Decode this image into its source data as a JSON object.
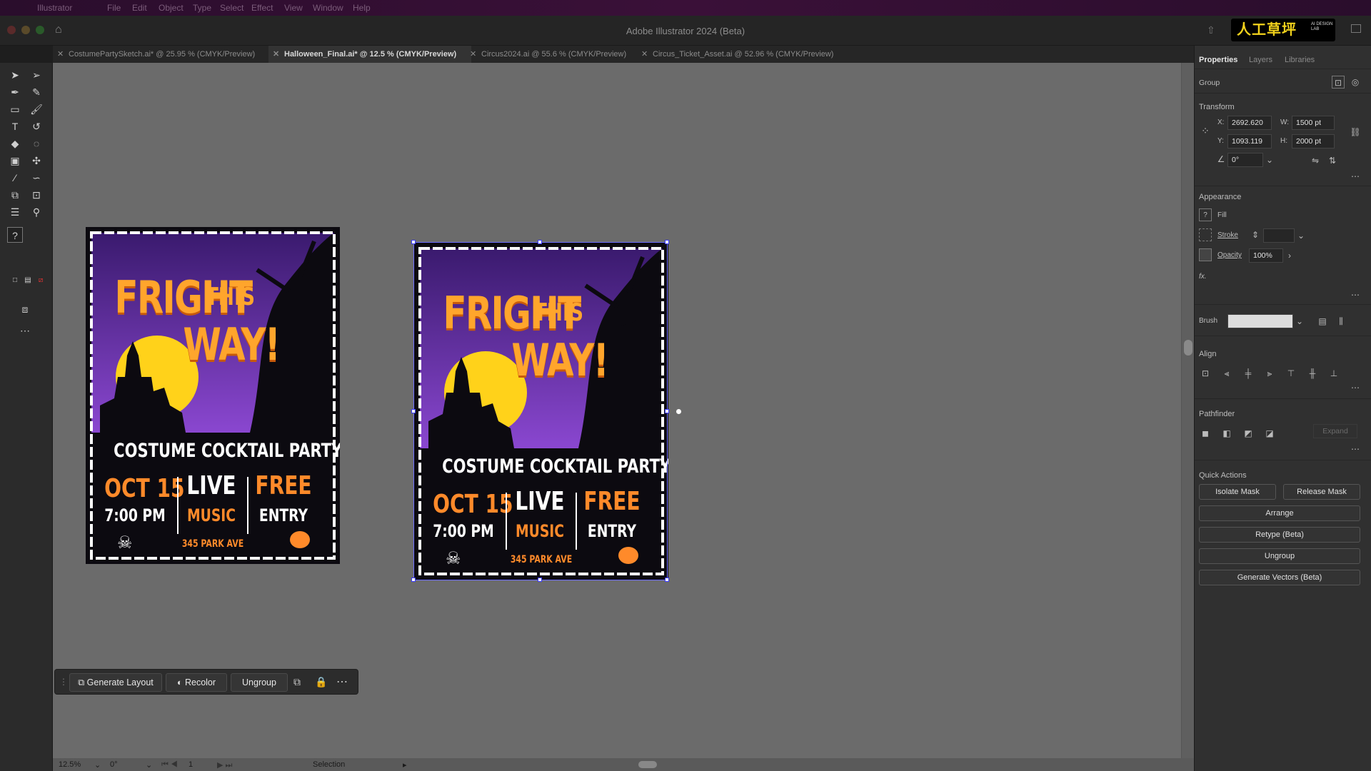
{
  "menubar": {
    "items": [
      "Illustrator",
      "File",
      "Edit",
      "Object",
      "Type",
      "Select",
      "Effect",
      "View",
      "Window",
      "Help"
    ]
  },
  "window": {
    "title": "Adobe Illustrator 2024 (Beta)",
    "brand_text": "人工草坪",
    "brand_small": "AI DESIGN LAB"
  },
  "tabs": [
    {
      "label": "CostumePartySketch.ai* @ 25.95 % (CMYK/Preview)",
      "active": false
    },
    {
      "label": "Halloween_Final.ai* @ 12.5 % (CMYK/Preview)",
      "active": true
    },
    {
      "label": "Circus2024.ai @ 55.6 % (CMYK/Preview)",
      "active": false
    },
    {
      "label": "Circus_Ticket_Asset.ai @ 52.96 % (CMYK/Preview)",
      "active": false
    }
  ],
  "panel": {
    "tabs": [
      "Properties",
      "Layers",
      "Libraries"
    ],
    "selection_type": "Group",
    "transform": {
      "title": "Transform",
      "x_label": "X:",
      "x": "2692.620",
      "y_label": "Y:",
      "y": "1093.119",
      "w_label": "W:",
      "w": "1500 pt",
      "h_label": "H:",
      "h": "2000 pt",
      "angle": "0°"
    },
    "appearance": {
      "title": "Appearance",
      "fill_label": "Fill",
      "stroke_label": "Stroke",
      "opacity_label": "Opacity",
      "opacity": "100%",
      "fx": "fx."
    },
    "brush_label": "Brush",
    "align_title": "Align",
    "pathfinder_title": "Pathfinder",
    "expand_label": "Expand",
    "quick_actions": {
      "title": "Quick Actions",
      "isolate_mask": "Isolate Mask",
      "release_mask": "Release Mask",
      "arrange": "Arrange",
      "retype": "Retype (Beta)",
      "ungroup": "Ungroup",
      "generate_vectors": "Generate Vectors (Beta)"
    }
  },
  "context_bar": {
    "generate_layout": "Generate Layout",
    "recolor": "Recolor",
    "ungroup": "Ungroup"
  },
  "status": {
    "zoom": "12.5%",
    "rotation": "0°",
    "artboard": "1",
    "tool": "Selection"
  },
  "poster": {
    "fright": "FRIGHT",
    "this": "THIS",
    "way": "WAY!",
    "subtitle": "COSTUME COCKTAIL PARTY",
    "date": "OCT 15",
    "time": "7:00 PM",
    "live": "LIVE",
    "music": "MUSIC",
    "free": "FREE",
    "entry": "ENTRY",
    "address": "345 PARK AVE"
  },
  "colors": {
    "poster_orange": "#ff9a2e",
    "poster_purple": "#6b2fb0",
    "moon": "#ffd21a",
    "selection": "#6d6dff"
  }
}
